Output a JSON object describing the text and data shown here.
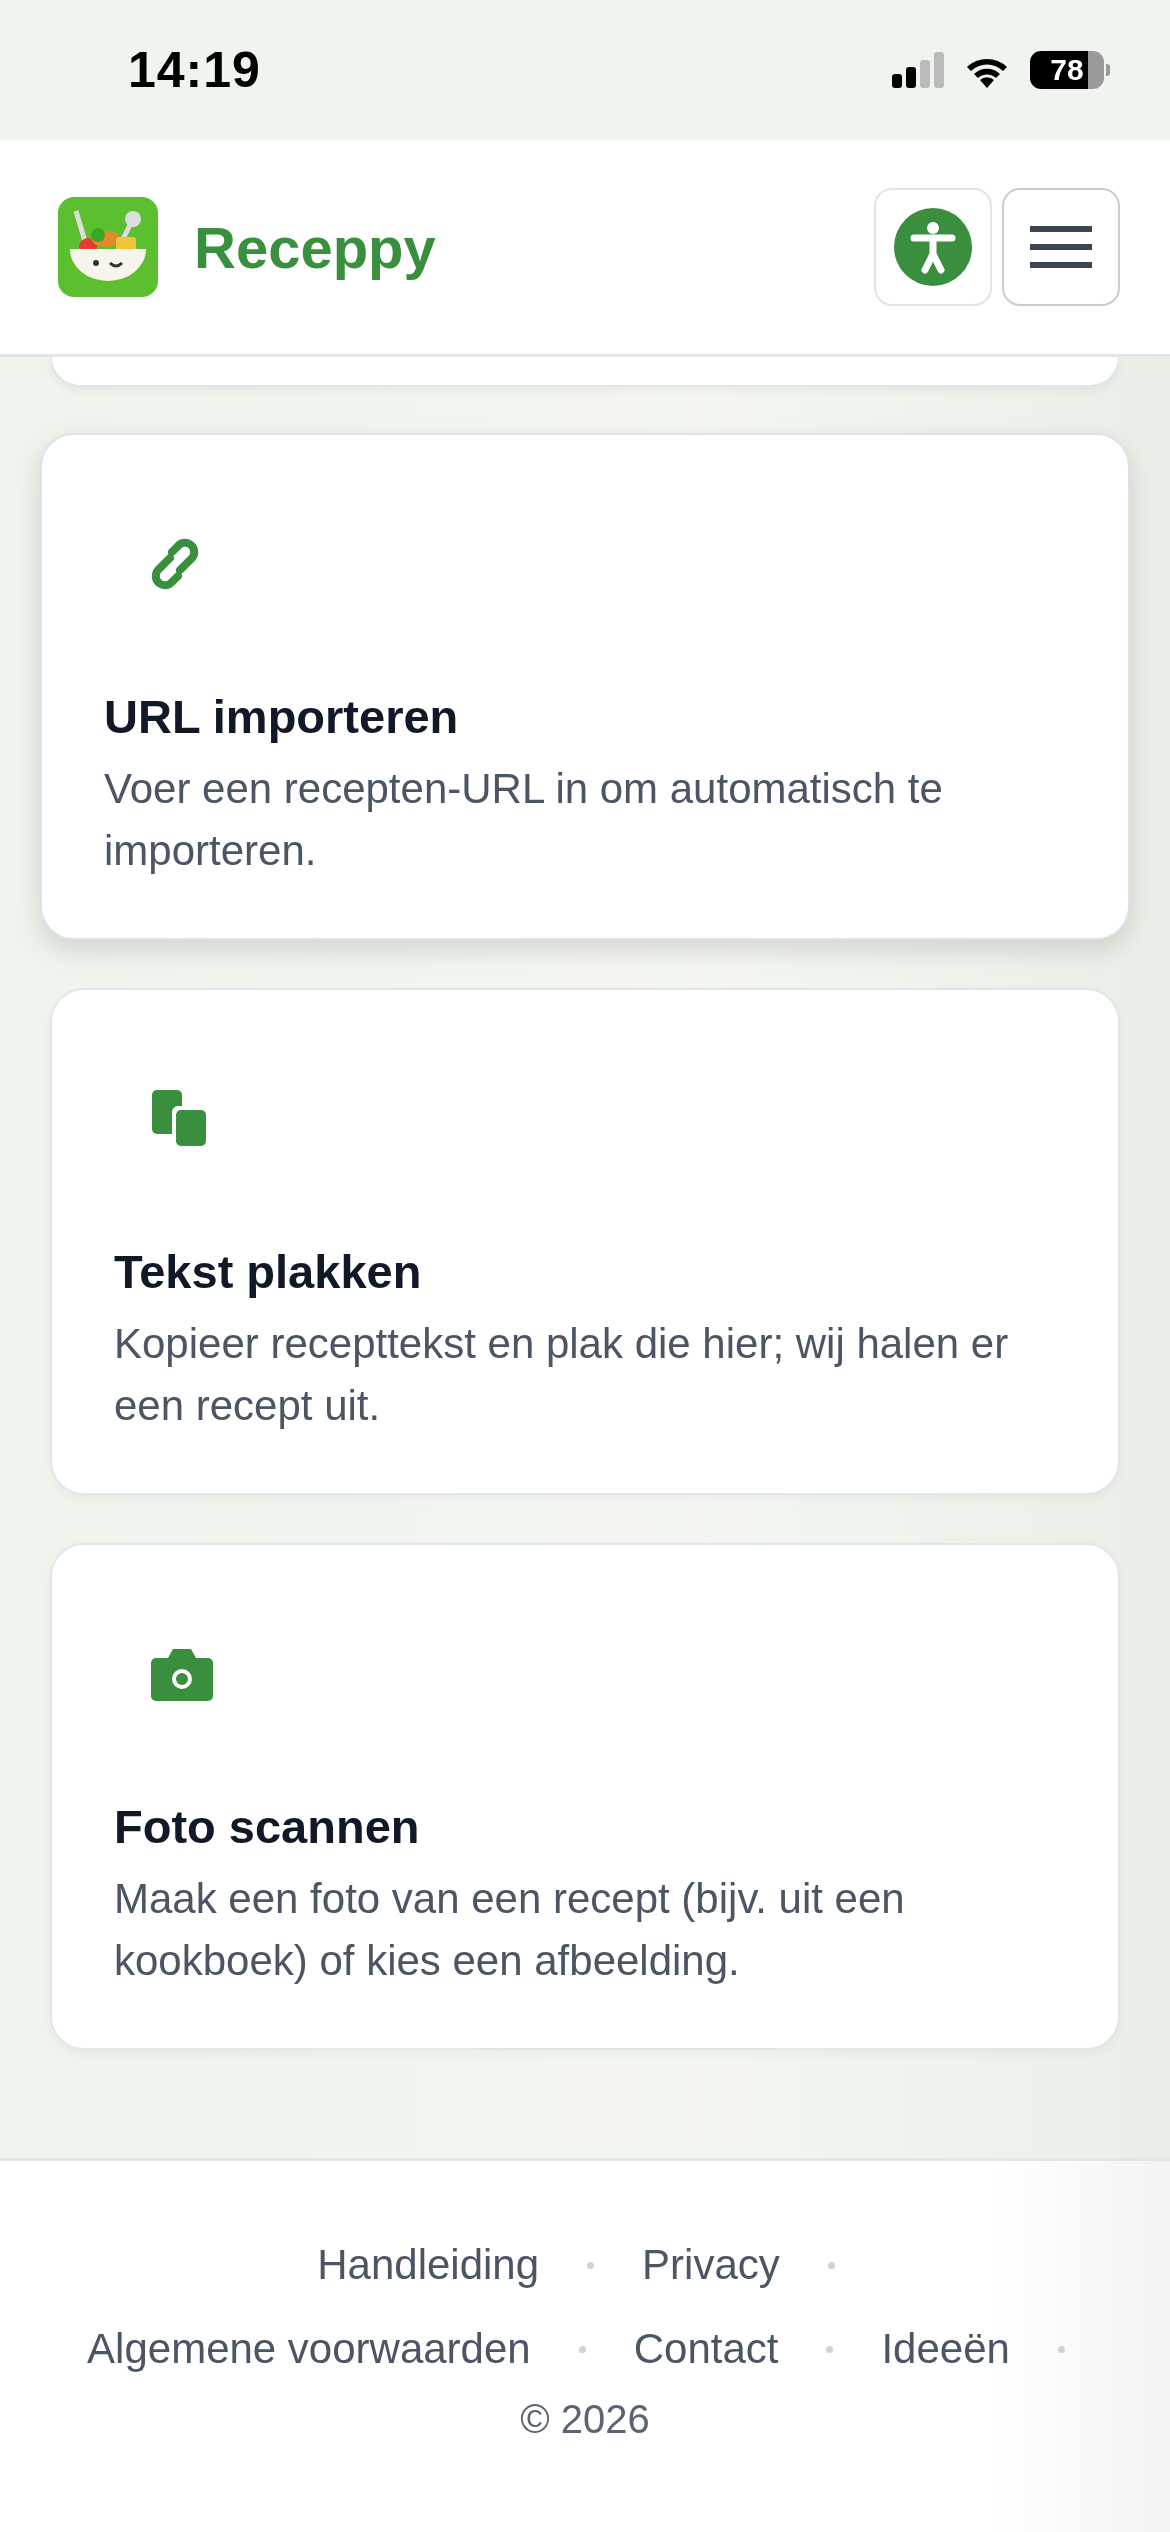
{
  "status_bar": {
    "time": "14:19",
    "battery": "78"
  },
  "header": {
    "brand": "Receppy"
  },
  "cards": [
    {
      "kind": "link",
      "title": "URL importeren",
      "description": "Voer een recepten-URL in om automatisch te importeren.",
      "selected": true
    },
    {
      "kind": "paste",
      "title": "Tekst plakken",
      "description": "Kopieer recepttekst en plak die hier; wij halen er een recept uit.",
      "selected": false
    },
    {
      "kind": "camera",
      "title": "Foto scannen",
      "description": "Maak een foto van een recept (bijv. uit een kookboek) of kies een afbeelding.",
      "selected": false
    }
  ],
  "footer": {
    "link_rows": [
      [
        "Handleiding",
        "Privacy"
      ],
      [
        "Algemene voorwaarden",
        "Contact",
        "Ideeën"
      ]
    ],
    "copyright": "© 2026"
  }
}
